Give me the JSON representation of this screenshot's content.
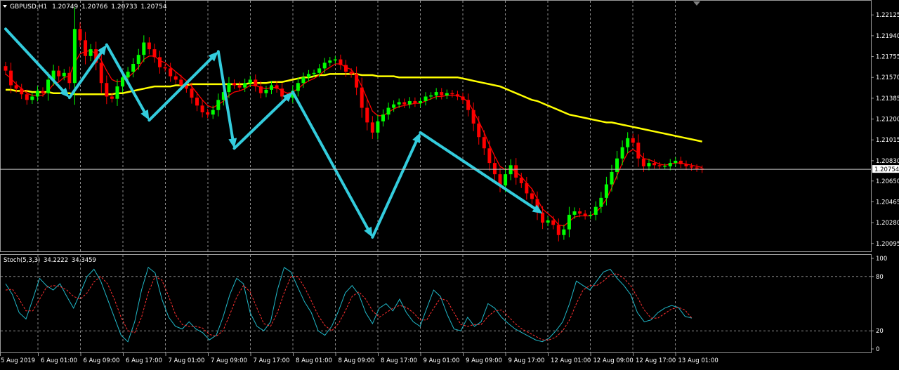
{
  "chart_data": [
    {
      "type": "candlestick",
      "symbol": "GBPUSD",
      "timeframe": "H1",
      "ohlc_header": [
        "1.20749",
        "1.20766",
        "1.20733",
        "1.20754"
      ],
      "ylim": [
        1.2005,
        1.2222
      ],
      "y_ticks": [
        "1.22125",
        "1.21940",
        "1.21755",
        "1.21570",
        "1.21385",
        "1.21200",
        "1.21015",
        "1.20830",
        "1.20650",
        "1.20465",
        "1.20280",
        "1.20095"
      ],
      "current_price": "1.20754",
      "x_ticks": [
        "5 Aug 2019",
        "6 Aug 01:00",
        "6 Aug 09:00",
        "6 Aug 17:00",
        "7 Aug 01:00",
        "7 Aug 09:00",
        "7 Aug 17:00",
        "8 Aug 01:00",
        "8 Aug 09:00",
        "8 Aug 17:00",
        "9 Aug 01:00",
        "9 Aug 09:00",
        "9 Aug 17:00",
        "12 Aug 01:00",
        "12 Aug 09:00",
        "12 Aug 17:00",
        "13 Aug 01:00"
      ],
      "close": [
        1.2163,
        1.215,
        1.2147,
        1.2142,
        1.2137,
        1.214,
        1.2145,
        1.2143,
        1.2155,
        1.2163,
        1.2158,
        1.2161,
        1.2152,
        1.22,
        1.219,
        1.2176,
        1.2182,
        1.217,
        1.2152,
        1.214,
        1.2138,
        1.2149,
        1.2157,
        1.2162,
        1.2169,
        1.2177,
        1.2188,
        1.2182,
        1.2175,
        1.2166,
        1.2165,
        1.2158,
        1.2155,
        1.215,
        1.2147,
        1.2139,
        1.2132,
        1.2126,
        1.2124,
        1.2128,
        1.2137,
        1.2144,
        1.2152,
        1.215,
        1.2148,
        1.2152,
        1.2155,
        1.2149,
        1.2143,
        1.2146,
        1.215,
        1.2147,
        1.214,
        1.2139,
        1.2145,
        1.2152,
        1.2157,
        1.216,
        1.2161,
        1.2165,
        1.217,
        1.2172,
        1.2173,
        1.2168,
        1.2162,
        1.216,
        1.2148,
        1.213,
        1.2117,
        1.2108,
        1.2118,
        1.2124,
        1.213,
        1.2133,
        1.2135,
        1.2133,
        1.2136,
        1.2134,
        1.2136,
        1.214,
        1.2141,
        1.2144,
        1.2141,
        1.2143,
        1.2142,
        1.214,
        1.2137,
        1.2128,
        1.2116,
        1.2104,
        1.2094,
        1.2081,
        1.2071,
        1.2061,
        1.2071,
        1.2079,
        1.2068,
        1.2063,
        1.2054,
        1.2049,
        1.2037,
        1.2028,
        1.203,
        1.2026,
        1.2017,
        1.2022,
        1.2035,
        1.2038,
        1.2036,
        1.2034,
        1.2035,
        1.2042,
        1.205,
        1.2062,
        1.2073,
        1.2085,
        1.2095,
        1.2103,
        1.2099,
        1.2085,
        1.2078,
        1.2081,
        1.2079,
        1.2078,
        1.2078,
        1.2081,
        1.2083,
        1.208,
        1.2078,
        1.2077,
        1.2076,
        1.2075
      ],
      "up_color": "#00ff00",
      "down_color": "#ff0000",
      "indicators": [
        {
          "type": "moving-average",
          "color": "#ffff00",
          "values": [
            1.2146,
            1.2146,
            1.2145,
            1.2145,
            1.2145,
            1.2144,
            1.2144,
            1.2144,
            1.2144,
            1.2143,
            1.2143,
            1.2143,
            1.2143,
            1.2142,
            1.2142,
            1.2142,
            1.2142,
            1.2142,
            1.2142,
            1.2142,
            1.2142,
            1.2143,
            1.2143,
            1.2144,
            1.2145,
            1.2146,
            1.2147,
            1.2148,
            1.2149,
            1.2149,
            1.2149,
            1.2149,
            1.215,
            1.215,
            1.215,
            1.2151,
            1.2151,
            1.2151,
            1.2151,
            1.2151,
            1.2151,
            1.2151,
            1.2151,
            1.2151,
            1.2151,
            1.2151,
            1.2152,
            1.2152,
            1.2152,
            1.2152,
            1.2153,
            1.2153,
            1.2153,
            1.2154,
            1.2155,
            1.2156,
            1.2157,
            1.2157,
            1.2158,
            1.2159,
            1.2159,
            1.216,
            1.216,
            1.216,
            1.216,
            1.216,
            1.216,
            1.2159,
            1.2159,
            1.2159,
            1.2158,
            1.2158,
            1.2158,
            1.2158,
            1.2157,
            1.2157,
            1.2157,
            1.2157,
            1.2157,
            1.2157,
            1.2157,
            1.2157,
            1.2157,
            1.2157,
            1.2157,
            1.2157,
            1.2156,
            1.2155,
            1.2154,
            1.2153,
            1.2152,
            1.2151,
            1.215,
            1.2149,
            1.2147,
            1.2145,
            1.2143,
            1.2141,
            1.2139,
            1.2137,
            1.2136,
            1.2134,
            1.2132,
            1.213,
            1.2128,
            1.2126,
            1.2124,
            1.2123,
            1.2122,
            1.2121,
            1.212,
            1.2119,
            1.2118,
            1.2117,
            1.2117,
            1.2116,
            1.2115,
            1.2114,
            1.2113,
            1.2112,
            1.2111,
            1.211,
            1.2109,
            1.2108,
            1.2107,
            1.2106,
            1.2105,
            1.2104,
            1.2103,
            1.2102,
            1.2101,
            1.21
          ]
        },
        {
          "type": "moving-average",
          "color": "#ff0000",
          "values": [
            1.216,
            1.2156,
            1.2151,
            1.2147,
            1.2143,
            1.2141,
            1.2141,
            1.2141,
            1.2145,
            1.2151,
            1.2153,
            1.2157,
            1.2158,
            1.217,
            1.2178,
            1.218,
            1.2181,
            1.2178,
            1.2172,
            1.2163,
            1.2155,
            1.2153,
            1.2154,
            1.2157,
            1.2161,
            1.2166,
            1.2173,
            1.2176,
            1.2176,
            1.2172,
            1.217,
            1.2166,
            1.2162,
            1.2158,
            1.2154,
            1.2149,
            1.2143,
            1.2137,
            1.2132,
            1.213,
            1.2133,
            1.2136,
            1.2141,
            1.2144,
            1.2145,
            1.2147,
            1.215,
            1.215,
            1.2148,
            1.2147,
            1.2148,
            1.2148,
            1.2145,
            1.2143,
            1.2144,
            1.2147,
            1.2151,
            1.2154,
            1.2156,
            1.2159,
            1.2163,
            1.2166,
            1.2169,
            1.2169,
            1.2166,
            1.2164,
            1.2158,
            1.2149,
            1.2138,
            1.2127,
            1.2123,
            1.2123,
            1.2126,
            1.2129,
            1.2131,
            1.2132,
            1.2133,
            1.2134,
            1.2134,
            1.2136,
            1.2138,
            1.214,
            1.214,
            1.2141,
            1.2141,
            1.2141,
            1.2139,
            1.2135,
            1.2127,
            1.2118,
            1.2108,
            1.2097,
            1.2087,
            1.2078,
            1.2075,
            1.2076,
            1.2073,
            1.2069,
            1.2063,
            1.2058,
            1.2049,
            1.204,
            1.2036,
            1.2032,
            1.2026,
            1.2025,
            1.2029,
            1.2033,
            1.2034,
            1.2034,
            1.2034,
            1.2037,
            1.2042,
            1.2049,
            1.2059,
            1.207,
            1.2081,
            1.209,
            1.2093,
            1.209,
            1.2085,
            1.2084,
            1.2082,
            1.208,
            1.2079,
            1.208,
            1.2081,
            1.2081,
            1.208,
            1.2079,
            1.2078,
            1.2077
          ]
        }
      ],
      "annotations": {
        "color": "#33ccdd",
        "zigzag": [
          [
            0,
            1.22
          ],
          [
            12,
            1.2139
          ],
          [
            19,
            1.2186
          ],
          [
            27,
            1.2119
          ],
          [
            40,
            1.218
          ],
          [
            43,
            1.2094
          ],
          [
            54,
            1.2144
          ],
          [
            69,
            1.2015
          ],
          [
            78,
            1.2108
          ],
          [
            101,
            1.2036
          ]
        ],
        "arrow_segments": [
          [
            0,
            1
          ],
          [
            1,
            2
          ],
          [
            2,
            3
          ],
          [
            3,
            4
          ],
          [
            4,
            5
          ],
          [
            5,
            6
          ],
          [
            6,
            7
          ],
          [
            7,
            8
          ],
          [
            8,
            9
          ]
        ]
      }
    },
    {
      "type": "line",
      "indicator": "Stoch(5,3,3)",
      "values_label": [
        "34.2222",
        "34.3459"
      ],
      "ylim": [
        0,
        100
      ],
      "y_ticks": [
        "100",
        "80",
        "20",
        "0"
      ],
      "levels": [
        80,
        20
      ],
      "series": [
        {
          "color": "#20b8c8",
          "values": [
            72,
            60,
            40,
            33,
            55,
            78,
            70,
            65,
            72,
            58,
            45,
            62,
            80,
            88,
            75,
            55,
            35,
            15,
            8,
            30,
            65,
            90,
            84,
            55,
            35,
            25,
            22,
            30,
            22,
            18,
            10,
            15,
            35,
            60,
            78,
            72,
            40,
            25,
            20,
            30,
            65,
            90,
            85,
            68,
            52,
            40,
            20,
            15,
            25,
            42,
            62,
            70,
            60,
            40,
            28,
            45,
            50,
            42,
            55,
            40,
            30,
            25,
            45,
            65,
            58,
            38,
            22,
            20,
            35,
            25,
            30,
            50,
            45,
            35,
            28,
            22,
            18,
            14,
            10,
            8,
            12,
            20,
            30,
            50,
            75,
            70,
            65,
            75,
            85,
            88,
            78,
            70,
            60,
            40,
            30,
            32,
            40,
            45,
            48,
            46,
            36,
            34
          ]
        },
        {
          "color": "#ff3030",
          "values": [
            65,
            66,
            55,
            42,
            42,
            55,
            68,
            70,
            69,
            65,
            58,
            55,
            62,
            74,
            80,
            72,
            55,
            35,
            20,
            18,
            35,
            62,
            80,
            76,
            58,
            38,
            27,
            25,
            25,
            23,
            16,
            14,
            20,
            38,
            57,
            70,
            63,
            45,
            28,
            25,
            40,
            62,
            80,
            80,
            68,
            53,
            37,
            26,
            20,
            28,
            42,
            58,
            63,
            55,
            42,
            35,
            40,
            45,
            48,
            46,
            40,
            32,
            32,
            45,
            56,
            53,
            40,
            27,
            25,
            27,
            27,
            36,
            42,
            43,
            36,
            28,
            22,
            18,
            14,
            10,
            10,
            13,
            20,
            32,
            50,
            65,
            70,
            70,
            75,
            82,
            83,
            78,
            70,
            57,
            43,
            34,
            34,
            39,
            44,
            46,
            43,
            34
          ]
        }
      ]
    }
  ]
}
